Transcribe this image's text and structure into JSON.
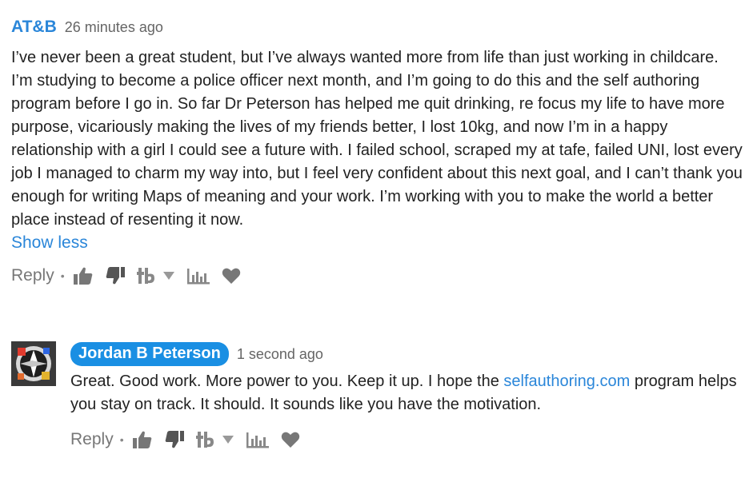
{
  "comment": {
    "author": "AT&B",
    "time": "26 minutes ago",
    "body": "I’ve never been a great student, but I’ve always wanted more from life than just working in childcare. I’m studying to become a police officer next month, and I’m going to do this and the self authoring program before I go in. So far Dr Peterson has helped me quit drinking, re focus my life to have more purpose, vicariously making the lives of my friends better, I lost 10kg, and now I’m in a happy relationship with a girl I could see a future with. I failed school, scraped my at tafe, failed UNI, lost every job I managed to charm my way into, but I feel very confident about this next goal, and I can’t thank you enough for writing Maps of meaning and your work. I’m working with you to make the world a better place instead of resenting it now.",
    "show_less": "Show less",
    "actions": {
      "reply": "Reply",
      "dot": "•"
    }
  },
  "reply": {
    "author": "Jordan B Peterson",
    "time": "1 second ago",
    "text_before": "Great. Good work. More power to you. Keep it up. I hope the ",
    "link": "selfauthoring.com",
    "text_after": " program helps you stay on track. It should. It sounds like you have the motivation.",
    "actions": {
      "reply": "Reply",
      "dot": "•"
    }
  },
  "icons": {
    "upvote": "thumbs-up-icon",
    "downvote": "thumbs-down-icon",
    "brand": "tb-logo-icon",
    "dropdown": "caret-down-icon",
    "stats": "bar-chart-icon",
    "favorite": "heart-icon"
  },
  "colors": {
    "link_blue": "#2a86d9",
    "badge_blue": "#1a8fe3",
    "icon_gray": "#777777"
  }
}
